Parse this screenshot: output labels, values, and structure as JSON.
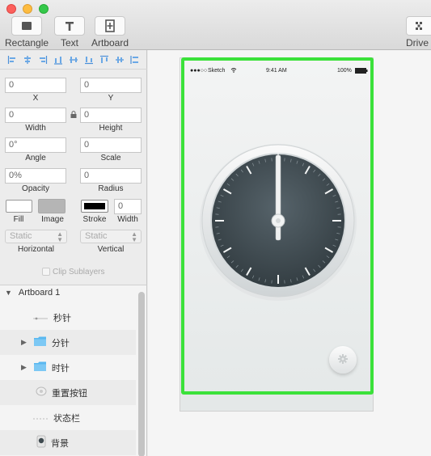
{
  "toolbar": {
    "items": [
      {
        "label": "Rectangle",
        "icon": "rectangle-icon"
      },
      {
        "label": "Text",
        "icon": "text-icon"
      },
      {
        "label": "Artboard",
        "icon": "artboard-icon"
      },
      {
        "label": "Drive",
        "icon": "drive-icon"
      }
    ]
  },
  "inspector": {
    "x": {
      "value": "0",
      "label": "X"
    },
    "y": {
      "value": "0",
      "label": "Y"
    },
    "width": {
      "value": "0",
      "label": "Width"
    },
    "height": {
      "value": "0",
      "label": "Height"
    },
    "angle": {
      "value": "0°",
      "label": "Angle"
    },
    "scale": {
      "value": "0",
      "label": "Scale"
    },
    "opacity": {
      "value": "0%",
      "label": "Opacity"
    },
    "radius": {
      "value": "0",
      "label": "Radius"
    },
    "fill_label": "Fill",
    "image_label": "Image",
    "stroke_label": "Stroke",
    "stroke_width": {
      "value": "0",
      "label": "Width"
    },
    "horizontal": {
      "value": "Static",
      "label": "Horizontal"
    },
    "vertical": {
      "value": "Static",
      "label": "Vertical"
    },
    "clip_sublayers": "Clip Sublayers"
  },
  "layers": {
    "artboard": "Artboard 1",
    "items": [
      {
        "name": "秒针",
        "icon": "line-icon"
      },
      {
        "name": "分针",
        "icon": "folder-icon"
      },
      {
        "name": "时针",
        "icon": "folder-icon"
      },
      {
        "name": "重置按钮",
        "icon": "button-thumbnail-icon"
      },
      {
        "name": "状态栏",
        "icon": "dotted-line-icon"
      },
      {
        "name": "背景",
        "icon": "phone-thumbnail-icon"
      }
    ]
  },
  "phone_status": {
    "carrier": "Sketch",
    "time": "9:41 AM",
    "battery": "100%"
  },
  "colors": {
    "selection": "#3be13a",
    "dial": "#3f4a4f",
    "folder": "#5ab8f0"
  }
}
